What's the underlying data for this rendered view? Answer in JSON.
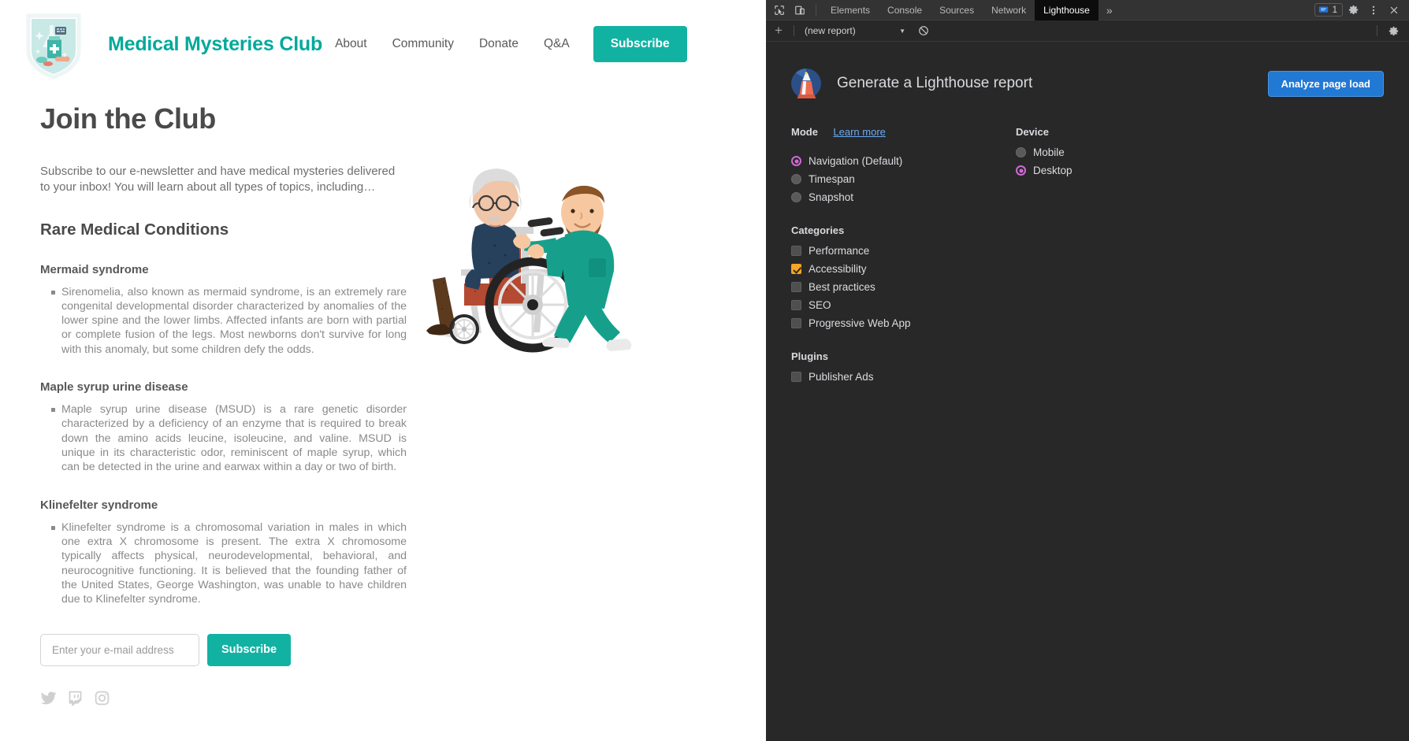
{
  "site": {
    "brand": "Medical Mysteries Club",
    "logo_icon": "medical-shield-badge-icon",
    "nav": [
      {
        "label": "About"
      },
      {
        "label": "Community"
      },
      {
        "label": "Donate"
      },
      {
        "label": "Q&A"
      }
    ],
    "nav_cta": "Subscribe",
    "accent_color": "#12b2a3",
    "brand_color": "#00a99b"
  },
  "main": {
    "title": "Join the Club",
    "intro": "Subscribe to our e-newsletter and have medical mysteries delivered to your inbox! You will learn about all types of topics, including…",
    "section_title": "Rare Medical Conditions",
    "conditions": [
      {
        "title": "Mermaid syndrome",
        "body": "Sirenomelia, also known as mermaid syndrome, is an extremely rare congenital developmental disorder characterized by anomalies of the lower spine and the lower limbs. Affected infants are born with partial or complete fusion of the legs. Most newborns don't survive for long with this anomaly, but some children defy the odds."
      },
      {
        "title": "Maple syrup urine disease",
        "body": "Maple syrup urine disease (MSUD) is a rare genetic disorder characterized by a deficiency of an enzyme that is required to break down the amino acids leucine, isoleucine, and valine. MSUD is unique in its characteristic odor, reminiscent of maple syrup, which can be detected in the urine and earwax within a day or two of birth."
      },
      {
        "title": "Klinefelter syndrome",
        "body": "Klinefelter syndrome is a chromosomal variation in males in which one extra X chromosome is present. The extra X chromosome typically affects physical, neurodevelopmental, behavioral, and neurocognitive functioning. It is believed that the founding father of the United States, George Washington, was unable to have children due to Klinefelter syndrome."
      }
    ],
    "illustration_icon": "nurse-pushing-wheelchair-illustration",
    "form": {
      "email_placeholder": "Enter your e-mail address",
      "email_value": "",
      "submit_label": "Subscribe"
    },
    "socials": [
      {
        "icon": "twitter-icon"
      },
      {
        "icon": "twitch-icon"
      },
      {
        "icon": "instagram-icon"
      }
    ]
  },
  "devtools": {
    "toolbar": {
      "inspect_icon": "inspect-element-icon",
      "device_icon": "device-toolbar-icon",
      "tabs": [
        {
          "label": "Elements",
          "active": false
        },
        {
          "label": "Console",
          "active": false
        },
        {
          "label": "Sources",
          "active": false
        },
        {
          "label": "Network",
          "active": false
        },
        {
          "label": "Lighthouse",
          "active": true
        }
      ],
      "overflow_label": "»",
      "issues_icon": "issues-icon",
      "issues_count": "1",
      "settings_icon": "gear-icon",
      "menu_icon": "three-dot-menu-icon",
      "close_icon": "close-icon"
    },
    "subbar": {
      "add_icon": "plus-icon",
      "report_selected": "(new report)",
      "dropdown_icon": "chevron-down-icon",
      "clear_icon": "clear-all-icon",
      "settings_icon": "gear-icon"
    },
    "lighthouse": {
      "logo_icon": "lighthouse-logo-icon",
      "title": "Generate a Lighthouse report",
      "analyze_label": "Analyze page load",
      "mode": {
        "heading": "Mode",
        "learn_more": "Learn more",
        "options": [
          {
            "label": "Navigation (Default)",
            "checked": true
          },
          {
            "label": "Timespan",
            "checked": false
          },
          {
            "label": "Snapshot",
            "checked": false
          }
        ]
      },
      "device": {
        "heading": "Device",
        "options": [
          {
            "label": "Mobile",
            "checked": false
          },
          {
            "label": "Desktop",
            "checked": true
          }
        ]
      },
      "categories": {
        "heading": "Categories",
        "options": [
          {
            "label": "Performance",
            "checked": false
          },
          {
            "label": "Accessibility",
            "checked": true
          },
          {
            "label": "Best practices",
            "checked": false
          },
          {
            "label": "SEO",
            "checked": false
          },
          {
            "label": "Progressive Web App",
            "checked": false
          }
        ]
      },
      "plugins": {
        "heading": "Plugins",
        "options": [
          {
            "label": "Publisher Ads",
            "checked": false
          }
        ]
      },
      "accent_radio_color": "#d268d8",
      "accent_check_color": "#f5a623",
      "button_color": "#2279d4"
    }
  }
}
